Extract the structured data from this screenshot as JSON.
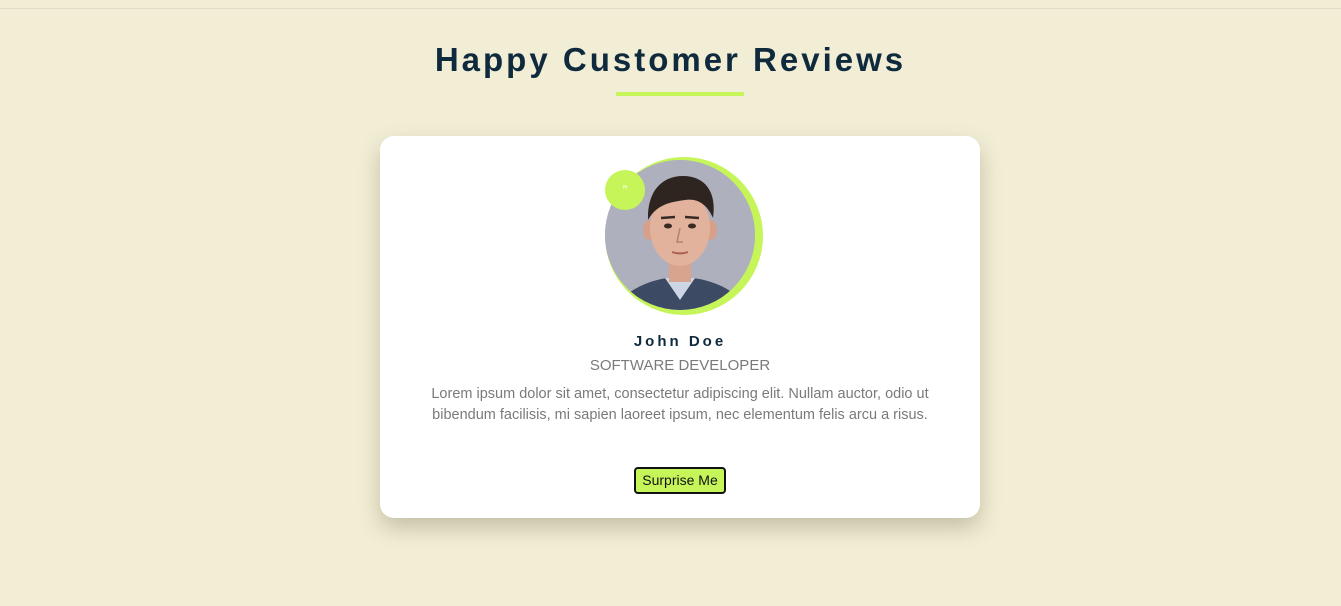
{
  "page": {
    "title": "Happy Customer Reviews"
  },
  "review": {
    "quote_icon": "quote-icon",
    "avatar_icon": "person-photo",
    "name": "John Doe",
    "role": "SOFTWARE DEVELOPER",
    "text": "Lorem ipsum dolor sit amet, consectetur adipiscing elit. Nullam auctor, odio ut bibendum facilisis, mi sapien laoreet ipsum, nec elementum felis arcu a risus.",
    "button_label": "Surprise Me"
  },
  "colors": {
    "background": "#f2eed6",
    "accent": "#c6f55a",
    "heading": "#0f2a3d",
    "muted_text": "#7a7a7a"
  }
}
